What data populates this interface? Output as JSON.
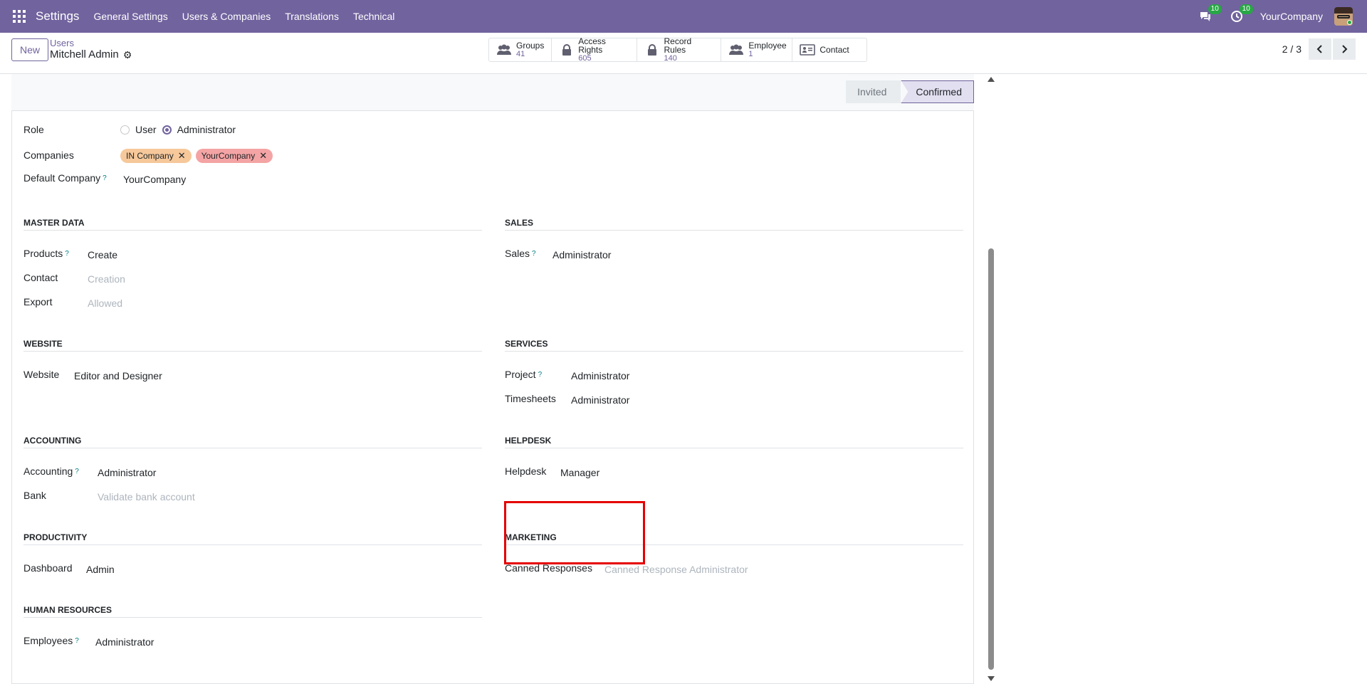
{
  "navbar": {
    "brand": "Settings",
    "menu": [
      "General Settings",
      "Users & Companies",
      "Translations",
      "Technical"
    ],
    "messages_count": "10",
    "activities_count": "10",
    "company": "YourCompany"
  },
  "control_panel": {
    "new_label": "New",
    "breadcrumb_parent": "Users",
    "breadcrumb_current": "Mitchell Admin",
    "smart_buttons": [
      {
        "label": "Groups",
        "value": "41",
        "icon": "users-icon"
      },
      {
        "label": "Access Rights",
        "value": "605",
        "icon": "lock-icon"
      },
      {
        "label": "Record Rules",
        "value": "140",
        "icon": "lock-icon"
      },
      {
        "label": "Employee",
        "value": "1",
        "icon": "users-icon"
      },
      {
        "label": "Contact",
        "value": "",
        "icon": "id-card-icon"
      }
    ],
    "pager": "2 / 3"
  },
  "statusbar": {
    "stages": [
      "Invited",
      "Confirmed"
    ],
    "active": "Confirmed"
  },
  "form": {
    "role": {
      "label": "Role",
      "options": [
        "User",
        "Administrator"
      ],
      "selected": "Administrator"
    },
    "companies": {
      "label": "Companies",
      "tags": [
        {
          "name": "IN Company",
          "color": "#f6c89a"
        },
        {
          "name": "YourCompany",
          "color": "#f4a4a4"
        }
      ]
    },
    "default_company": {
      "label": "Default Company",
      "value": "YourCompany"
    },
    "sections": {
      "master_data": {
        "title": "MASTER DATA",
        "fields": [
          {
            "label": "Products",
            "value": "Create",
            "help": true,
            "empty": false
          },
          {
            "label": "Contact",
            "value": "Creation",
            "help": false,
            "empty": true
          },
          {
            "label": "Export",
            "value": "Allowed",
            "help": false,
            "empty": true
          }
        ]
      },
      "sales": {
        "title": "SALES",
        "fields": [
          {
            "label": "Sales",
            "value": "Administrator",
            "help": true,
            "empty": false
          }
        ]
      },
      "website": {
        "title": "WEBSITE",
        "fields": [
          {
            "label": "Website",
            "value": "Editor and Designer",
            "help": false,
            "empty": false
          }
        ]
      },
      "services": {
        "title": "SERVICES",
        "fields": [
          {
            "label": "Project",
            "value": "Administrator",
            "help": true,
            "empty": false
          },
          {
            "label": "Timesheets",
            "value": "Administrator",
            "help": false,
            "empty": false
          }
        ]
      },
      "accounting": {
        "title": "ACCOUNTING",
        "fields": [
          {
            "label": "Accounting",
            "value": "Administrator",
            "help": true,
            "empty": false
          },
          {
            "label": "Bank",
            "value": "Validate bank account",
            "help": false,
            "empty": true
          }
        ]
      },
      "helpdesk": {
        "title": "HELPDESK",
        "fields": [
          {
            "label": "Helpdesk",
            "value": "Manager",
            "help": false,
            "empty": false
          }
        ]
      },
      "productivity": {
        "title": "PRODUCTIVITY",
        "fields": [
          {
            "label": "Dashboard",
            "value": "Admin",
            "help": false,
            "empty": false
          }
        ]
      },
      "marketing": {
        "title": "MARKETING",
        "fields": [
          {
            "label": "Canned Responses",
            "value": "Canned Response Administrator",
            "help": false,
            "empty": true
          }
        ]
      },
      "human_resources": {
        "title": "HUMAN RESOURCES",
        "fields": [
          {
            "label": "Employees",
            "value": "Administrator",
            "help": true,
            "empty": false
          }
        ]
      }
    }
  },
  "help_mark": "?",
  "colors": {
    "brand": "#71639e",
    "highlight": "#e60000"
  }
}
